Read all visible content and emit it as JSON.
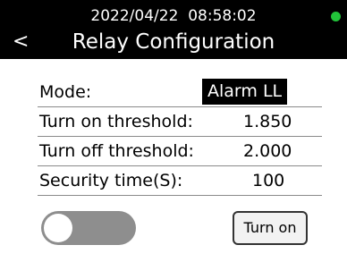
{
  "status_bar": {
    "datetime": "2022/04/22  08:58:02",
    "indicator_color": "#22c33a"
  },
  "header": {
    "back_label": "<",
    "title": "Relay Configuration"
  },
  "settings": [
    {
      "label": "Mode:",
      "value": "Alarm LL"
    },
    {
      "label": "Turn on threshold:",
      "value": "1.850"
    },
    {
      "label": "Turn off threshold:",
      "value": "2.000"
    },
    {
      "label": "Security time(S):",
      "value": "100"
    }
  ],
  "controls": {
    "toggle_state": "off",
    "turn_on_label": "Turn on"
  }
}
